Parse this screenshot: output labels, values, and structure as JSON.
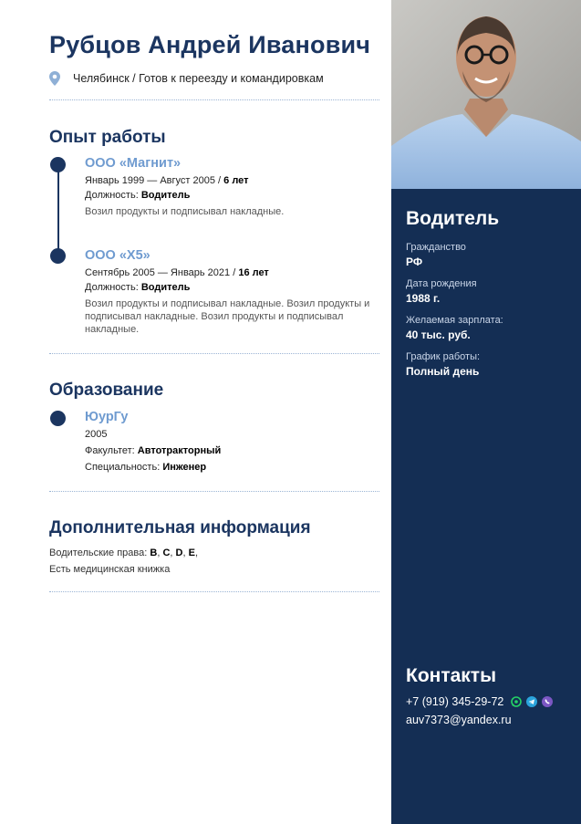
{
  "header": {
    "name": "Рубцов Андрей Иванович",
    "location": "Челябинск / Готов к переезду и командировкам"
  },
  "experience": {
    "title": "Опыт работы",
    "items": [
      {
        "company": "ООО «Магнит»",
        "period": "Январь 1999 — Август 2005 / ",
        "duration": "6 лет",
        "position_label": "Должность: ",
        "position": "Водитель",
        "description": "Возил продукты и подписывал накладные."
      },
      {
        "company": "ООО «Х5»",
        "period": "Сентябрь 2005 — Январь 2021 / ",
        "duration": "16 лет",
        "position_label": "Должность: ",
        "position": "Водитель",
        "description": "Возил продукты и подписывал накладные. Возил продукты и подписывал накладные. Возил продукты и подписывал накладные."
      }
    ]
  },
  "education": {
    "title": "Образование",
    "items": [
      {
        "institution": "ЮурГу",
        "year": "2005",
        "faculty_label": "Факультет: ",
        "faculty": "Автотракторный",
        "specialty_label": "Специальность: ",
        "specialty": "Инженер"
      }
    ]
  },
  "additional": {
    "title": "Дополнительная информация",
    "license_label": "Водительские права: ",
    "license_categories": [
      "B",
      "C",
      "D",
      "E"
    ],
    "medical": "Есть медицинская книжка"
  },
  "sidebar": {
    "role": "Водитель",
    "facts": [
      {
        "label": "Гражданство",
        "value": "РФ"
      },
      {
        "label": "Дата рождения",
        "value": "1988 г."
      },
      {
        "label": "Желаемая зарплата:",
        "value": "40 тыс. руб."
      },
      {
        "label": "График работы:",
        "value": "Полный день"
      }
    ],
    "contacts_title": "Контакты",
    "phone": "+7 (919) 345-29-72",
    "email": "auv7373@yandex.ru",
    "messenger_icons": [
      "whatsapp-icon",
      "telegram-icon",
      "viber-icon"
    ]
  },
  "colors": {
    "accent": "#1b3560",
    "company": "#6f9bd0",
    "sidebar_bg": "#142e54",
    "whatsapp": "#25d366",
    "telegram": "#2aa3dc",
    "viber": "#7b57c3"
  }
}
